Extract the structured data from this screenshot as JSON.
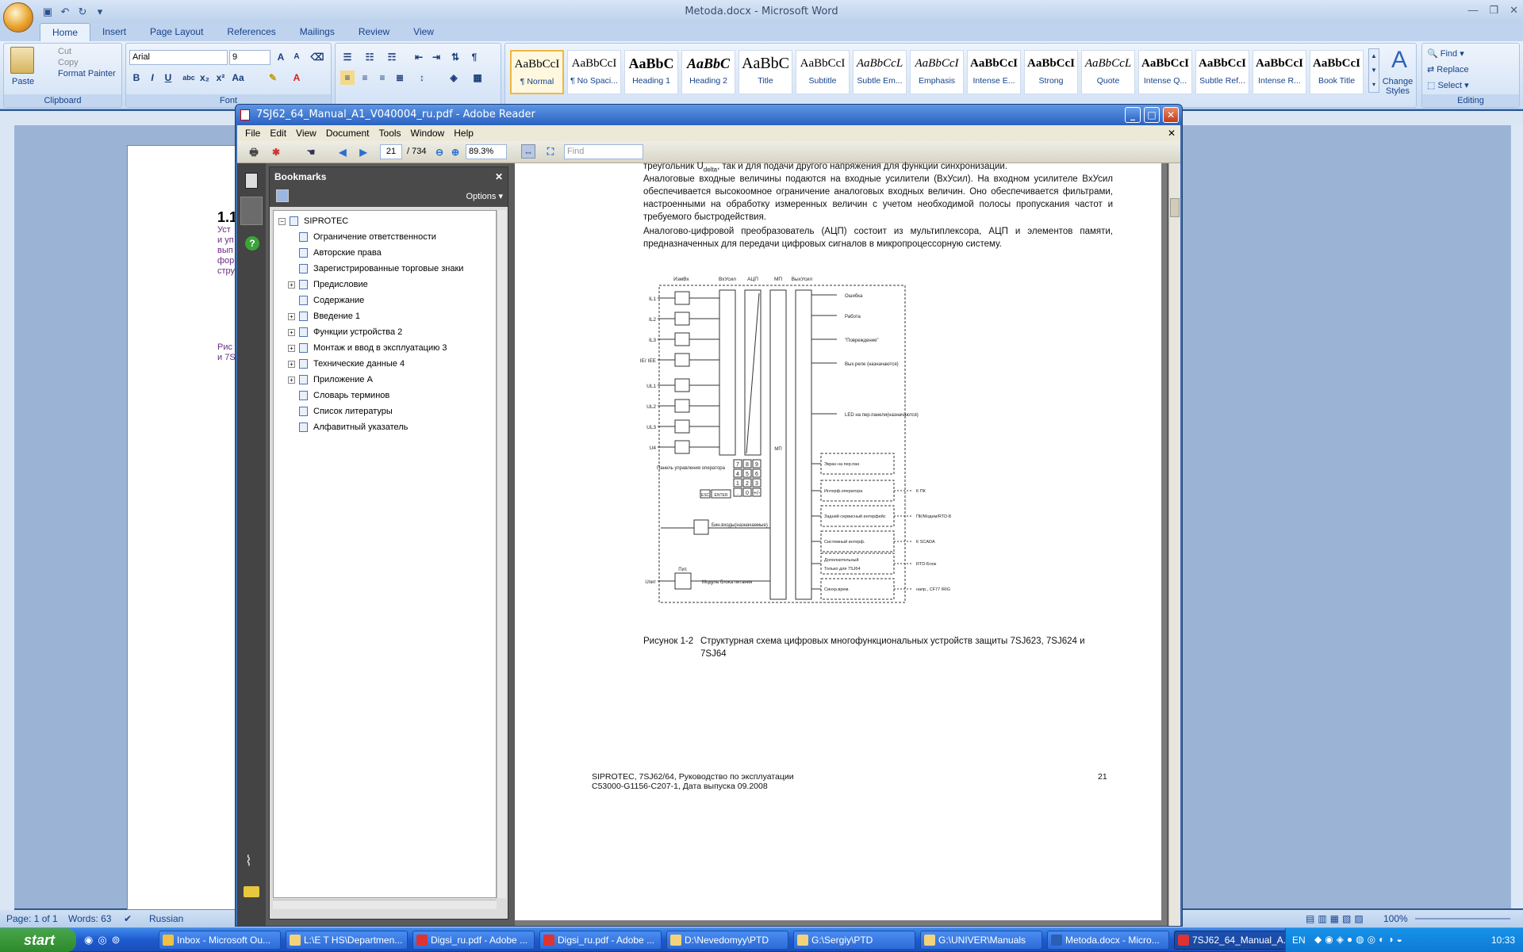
{
  "word": {
    "title": "Metoda.docx - Microsoft Word",
    "tabs": [
      "Home",
      "Insert",
      "Page Layout",
      "References",
      "Mailings",
      "Review",
      "View"
    ],
    "clipboard": {
      "paste": "Paste",
      "cut": "Cut",
      "copy": "Copy",
      "format_painter": "Format Painter",
      "label": "Clipboard"
    },
    "font": {
      "name": "Arial",
      "size": "9",
      "label": "Font"
    },
    "styles": [
      {
        "preview": "AaBbCcI",
        "name": "¶ Normal"
      },
      {
        "preview": "AaBbCcI",
        "name": "¶ No Spaci..."
      },
      {
        "preview": "AaBbC",
        "name": "Heading 1"
      },
      {
        "preview": "AaBbC",
        "name": "Heading 2"
      },
      {
        "preview": "AaBbC",
        "name": "Title"
      },
      {
        "preview": "AaBbCcI",
        "name": "Subtitle"
      },
      {
        "preview": "AaBbCcL",
        "name": "Subtle Em..."
      },
      {
        "preview": "AaBbCcI",
        "name": "Emphasis"
      },
      {
        "preview": "AaBbCcI",
        "name": "Intense E..."
      },
      {
        "preview": "AaBbCcI",
        "name": "Strong"
      },
      {
        "preview": "AaBbCcL",
        "name": "Quote"
      },
      {
        "preview": "AaBbCcI",
        "name": "Intense Q..."
      },
      {
        "preview": "AaBbCcI",
        "name": "Subtle Ref..."
      },
      {
        "preview": "AaBbCcI",
        "name": "Intense R..."
      },
      {
        "preview": "AaBbCcI",
        "name": "Book Title"
      }
    ],
    "change_styles": "Change Styles",
    "editing": {
      "find": "Find",
      "replace": "Replace",
      "select": "Select",
      "label": "Editing"
    },
    "doc_fragments": [
      "1.1",
      "Уст",
      "и уп",
      "вып",
      "фор",
      "стру",
      "Рис",
      "и 7S"
    ],
    "status": {
      "page": "Page: 1 of 1",
      "words": "Words: 63",
      "lang": "Russian",
      "zoom": "100%"
    }
  },
  "adobe": {
    "title": "7SJ62_64_Manual_A1_V040004_ru.pdf - Adobe Reader",
    "menu": [
      "File",
      "Edit",
      "View",
      "Document",
      "Tools",
      "Window",
      "Help"
    ],
    "page_current": "21",
    "page_total": "/ 734",
    "zoom": "89.3%",
    "find_placeholder": "Find",
    "bookmarks_title": "Bookmarks",
    "options_label": "Options",
    "bookmarks": [
      {
        "label": "SIPROTEC",
        "expand": "minus",
        "level": 0
      },
      {
        "label": "Ограничение ответственности",
        "expand": "",
        "level": 1
      },
      {
        "label": "Авторские права",
        "expand": "",
        "level": 1
      },
      {
        "label": "Зарегистрированные торговые знаки",
        "expand": "",
        "level": 1
      },
      {
        "label": "Предисловие",
        "expand": "plus",
        "level": 1
      },
      {
        "label": "Содержание",
        "expand": "",
        "level": 1
      },
      {
        "label": "Введение 1",
        "expand": "plus",
        "level": 1
      },
      {
        "label": "Функции устройства 2",
        "expand": "plus",
        "level": 1
      },
      {
        "label": "Монтаж и ввод в эксплуатацию 3",
        "expand": "plus",
        "level": 1
      },
      {
        "label": "Технические данные 4",
        "expand": "plus",
        "level": 1
      },
      {
        "label": "Приложение А",
        "expand": "plus",
        "level": 1
      },
      {
        "label": "Словарь терминов",
        "expand": "",
        "level": 1
      },
      {
        "label": "Список литературы",
        "expand": "",
        "level": 1
      },
      {
        "label": "Алфавитный указатель",
        "expand": "",
        "level": 1
      }
    ],
    "page_text": {
      "line0": "треугольник U",
      "line0_sub": "delta",
      "line0_rest": ", так и для подачи другого напряжения для функции синхронизации.",
      "para1": "Аналоговые входные величины подаются на входные усилители (ВхУсил). На входном усилителе ВхУсил обеспечивается высокоомное ограничение аналоговых входных величин. Оно обеспечивается фильтрами, настроенными на обработку измеренных величин с учетом необходимой полосы пропускания частот и требуемого быстродействия.",
      "para2": "Аналогово-цифровой преобразователь (АЦП) состоит из мультиплексора, АЦП и элементов памяти, предназначенных для передачи цифровых сигналов в микропроцессорную систему.",
      "caption_num": "Рисунок 1-2",
      "caption": "Структурная схема цифровых многофункциональных устройств защиты 7SJ623, 7SJ624 и 7SJ64",
      "footer1": "SIPROTEC, 7SJ62/64, Руководство по эксплуатации",
      "footer2": "C53000-G1156-C207-1, Дата выпуска 09.2008",
      "page_no": "21"
    },
    "diagram": {
      "col_labels": [
        "ИзмВх",
        "ВхУсил",
        "АЦП",
        "МП",
        "ВыхУсил"
      ],
      "inputs": [
        "IL1",
        "IL2",
        "IL3",
        "IE/ IEE",
        "UL1",
        "UL2",
        "UL3",
        "U4"
      ],
      "outputs": [
        "Ошибка",
        "Работа",
        "\"Повреждение\"",
        "Вых.реле (назначаются)",
        "LED на пер.панели(назначаются)"
      ],
      "mp_label": "МП",
      "panel_label": "Панель управления оператора",
      "keys": [
        "7",
        "8",
        "9",
        "4",
        "5",
        "6",
        "1",
        "2",
        "3",
        ".",
        "0",
        "+/-"
      ],
      "esc": "ESC",
      "enter": "ENTER",
      "binary": "Бин.входы(назначаемые)",
      "power_in": "Uпит",
      "power_box": "Пит.",
      "power_label": "Модуль блока питания",
      "boxes": [
        "Экран на пер.пан",
        "Интерф.оператора",
        "Задний сервисный интерфейс",
        "Системный интерф.",
        "Дополнительный",
        "Только для 7SJ64",
        "Синхр.врем."
      ],
      "targets": [
        "К ПК",
        "ПК/Модем/RTD-Блок",
        "К SCADA",
        "RTD-Блок",
        "напр., CF77 IRIG B"
      ]
    }
  },
  "taskbar": {
    "start": "start",
    "items": [
      "Inbox - Microsoft Ou...",
      "L:\\E T HS\\Departmen...",
      "Digsi_ru.pdf - Adobe ...",
      "Digsi_ru.pdf - Adobe ...",
      "D:\\Nevedomyy\\PTD",
      "G:\\Sergiy\\PTD",
      "G:\\UNIVER\\Manuals",
      "Metoda.docx - Micro...",
      "7SJ62_64_Manual_A..."
    ],
    "lang": "EN",
    "clock": "10:33"
  }
}
